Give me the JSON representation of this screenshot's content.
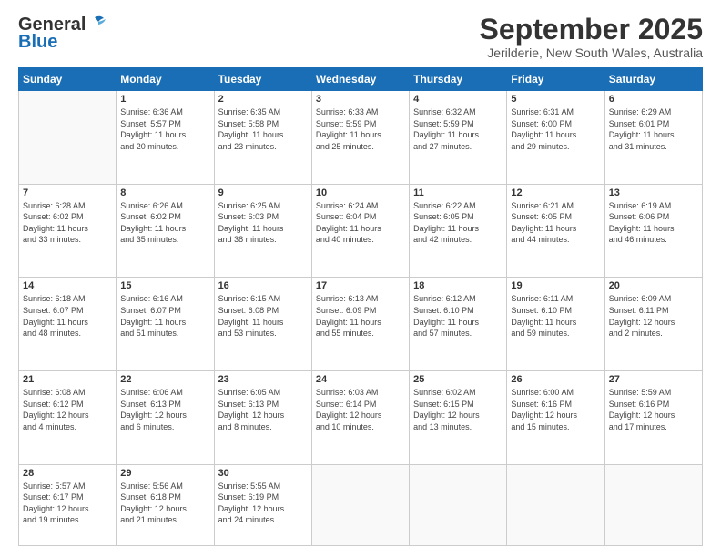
{
  "header": {
    "logo_general": "General",
    "logo_blue": "Blue",
    "month_title": "September 2025",
    "location": "Jerilderie, New South Wales, Australia"
  },
  "days_of_week": [
    "Sunday",
    "Monday",
    "Tuesday",
    "Wednesday",
    "Thursday",
    "Friday",
    "Saturday"
  ],
  "weeks": [
    [
      {
        "day": "",
        "info": ""
      },
      {
        "day": "1",
        "info": "Sunrise: 6:36 AM\nSunset: 5:57 PM\nDaylight: 11 hours\nand 20 minutes."
      },
      {
        "day": "2",
        "info": "Sunrise: 6:35 AM\nSunset: 5:58 PM\nDaylight: 11 hours\nand 23 minutes."
      },
      {
        "day": "3",
        "info": "Sunrise: 6:33 AM\nSunset: 5:59 PM\nDaylight: 11 hours\nand 25 minutes."
      },
      {
        "day": "4",
        "info": "Sunrise: 6:32 AM\nSunset: 5:59 PM\nDaylight: 11 hours\nand 27 minutes."
      },
      {
        "day": "5",
        "info": "Sunrise: 6:31 AM\nSunset: 6:00 PM\nDaylight: 11 hours\nand 29 minutes."
      },
      {
        "day": "6",
        "info": "Sunrise: 6:29 AM\nSunset: 6:01 PM\nDaylight: 11 hours\nand 31 minutes."
      }
    ],
    [
      {
        "day": "7",
        "info": "Sunrise: 6:28 AM\nSunset: 6:02 PM\nDaylight: 11 hours\nand 33 minutes."
      },
      {
        "day": "8",
        "info": "Sunrise: 6:26 AM\nSunset: 6:02 PM\nDaylight: 11 hours\nand 35 minutes."
      },
      {
        "day": "9",
        "info": "Sunrise: 6:25 AM\nSunset: 6:03 PM\nDaylight: 11 hours\nand 38 minutes."
      },
      {
        "day": "10",
        "info": "Sunrise: 6:24 AM\nSunset: 6:04 PM\nDaylight: 11 hours\nand 40 minutes."
      },
      {
        "day": "11",
        "info": "Sunrise: 6:22 AM\nSunset: 6:05 PM\nDaylight: 11 hours\nand 42 minutes."
      },
      {
        "day": "12",
        "info": "Sunrise: 6:21 AM\nSunset: 6:05 PM\nDaylight: 11 hours\nand 44 minutes."
      },
      {
        "day": "13",
        "info": "Sunrise: 6:19 AM\nSunset: 6:06 PM\nDaylight: 11 hours\nand 46 minutes."
      }
    ],
    [
      {
        "day": "14",
        "info": "Sunrise: 6:18 AM\nSunset: 6:07 PM\nDaylight: 11 hours\nand 48 minutes."
      },
      {
        "day": "15",
        "info": "Sunrise: 6:16 AM\nSunset: 6:07 PM\nDaylight: 11 hours\nand 51 minutes."
      },
      {
        "day": "16",
        "info": "Sunrise: 6:15 AM\nSunset: 6:08 PM\nDaylight: 11 hours\nand 53 minutes."
      },
      {
        "day": "17",
        "info": "Sunrise: 6:13 AM\nSunset: 6:09 PM\nDaylight: 11 hours\nand 55 minutes."
      },
      {
        "day": "18",
        "info": "Sunrise: 6:12 AM\nSunset: 6:10 PM\nDaylight: 11 hours\nand 57 minutes."
      },
      {
        "day": "19",
        "info": "Sunrise: 6:11 AM\nSunset: 6:10 PM\nDaylight: 11 hours\nand 59 minutes."
      },
      {
        "day": "20",
        "info": "Sunrise: 6:09 AM\nSunset: 6:11 PM\nDaylight: 12 hours\nand 2 minutes."
      }
    ],
    [
      {
        "day": "21",
        "info": "Sunrise: 6:08 AM\nSunset: 6:12 PM\nDaylight: 12 hours\nand 4 minutes."
      },
      {
        "day": "22",
        "info": "Sunrise: 6:06 AM\nSunset: 6:13 PM\nDaylight: 12 hours\nand 6 minutes."
      },
      {
        "day": "23",
        "info": "Sunrise: 6:05 AM\nSunset: 6:13 PM\nDaylight: 12 hours\nand 8 minutes."
      },
      {
        "day": "24",
        "info": "Sunrise: 6:03 AM\nSunset: 6:14 PM\nDaylight: 12 hours\nand 10 minutes."
      },
      {
        "day": "25",
        "info": "Sunrise: 6:02 AM\nSunset: 6:15 PM\nDaylight: 12 hours\nand 13 minutes."
      },
      {
        "day": "26",
        "info": "Sunrise: 6:00 AM\nSunset: 6:16 PM\nDaylight: 12 hours\nand 15 minutes."
      },
      {
        "day": "27",
        "info": "Sunrise: 5:59 AM\nSunset: 6:16 PM\nDaylight: 12 hours\nand 17 minutes."
      }
    ],
    [
      {
        "day": "28",
        "info": "Sunrise: 5:57 AM\nSunset: 6:17 PM\nDaylight: 12 hours\nand 19 minutes."
      },
      {
        "day": "29",
        "info": "Sunrise: 5:56 AM\nSunset: 6:18 PM\nDaylight: 12 hours\nand 21 minutes."
      },
      {
        "day": "30",
        "info": "Sunrise: 5:55 AM\nSunset: 6:19 PM\nDaylight: 12 hours\nand 24 minutes."
      },
      {
        "day": "",
        "info": ""
      },
      {
        "day": "",
        "info": ""
      },
      {
        "day": "",
        "info": ""
      },
      {
        "day": "",
        "info": ""
      }
    ]
  ]
}
